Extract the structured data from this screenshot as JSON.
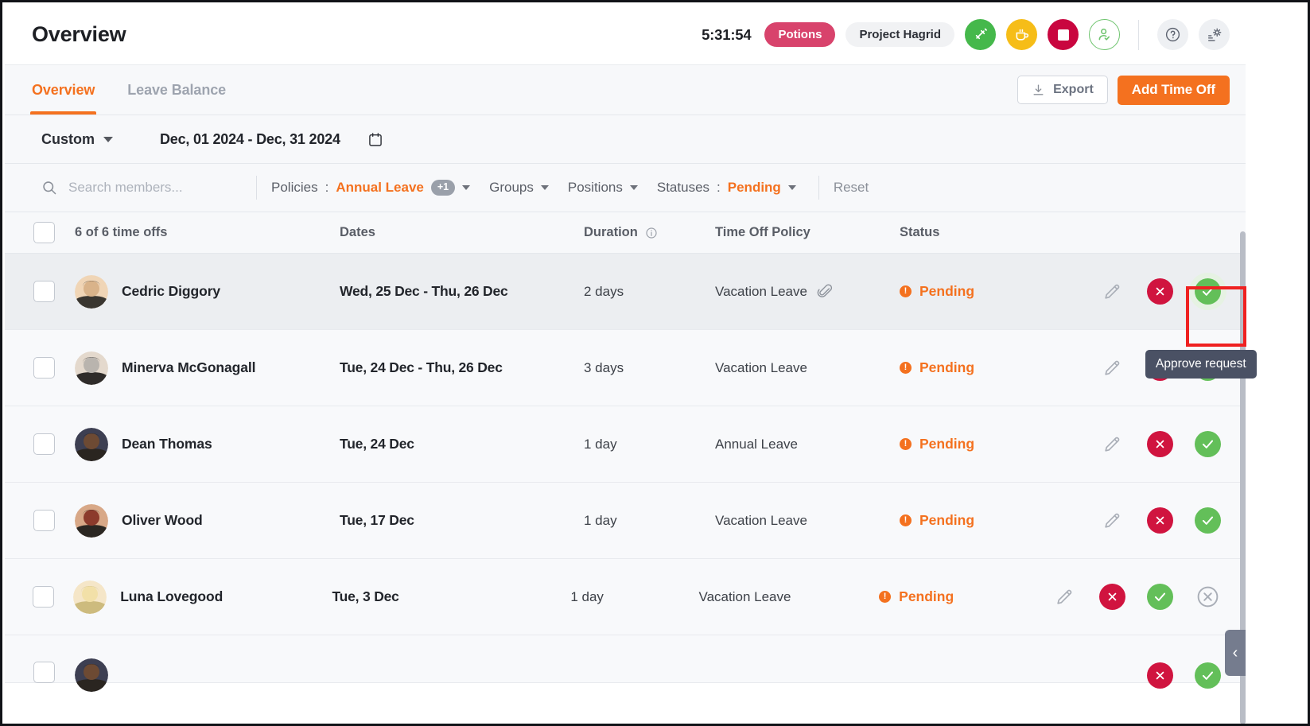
{
  "header": {
    "title": "Overview",
    "clock": "5:31:54",
    "task_pill": "Potions",
    "project_pill": "Project Hagrid",
    "icons": {
      "resume": "tracker-resume-icon",
      "break": "coffee-break-icon",
      "stop": "stop-tracker-icon",
      "checkin": "person-check-icon",
      "help": "help-icon",
      "settings": "settings-icon"
    }
  },
  "tabs": [
    {
      "label": "Overview",
      "active": true
    },
    {
      "label": "Leave Balance",
      "active": false
    }
  ],
  "actions": {
    "export_label": "Export",
    "add_label": "Add Time Off"
  },
  "daterange": {
    "preset": "Custom",
    "range": "Dec, 01 2024 - Dec, 31 2024"
  },
  "filters": {
    "search_placeholder": "Search members...",
    "search_value": "",
    "policies_label": "Policies",
    "policies_value": "Annual Leave",
    "policies_extra": "+1",
    "groups_label": "Groups",
    "positions_label": "Positions",
    "statuses_label": "Statuses",
    "statuses_value": "Pending",
    "reset_label": "Reset"
  },
  "table": {
    "count_label": "6 of 6 time offs",
    "columns": [
      "Dates",
      "Duration",
      "Time Off Policy",
      "Status"
    ],
    "rows": [
      {
        "name": "Cedric Diggory",
        "dates": "Wed, 25 Dec - Thu, 26 Dec",
        "duration": "2 days",
        "policy": "Vacation Leave",
        "has_attachment": true,
        "status": "Pending",
        "highlighted": true,
        "has_cancel": false
      },
      {
        "name": "Minerva McGonagall",
        "dates": "Tue, 24 Dec - Thu, 26 Dec",
        "duration": "3 days",
        "policy": "Vacation Leave",
        "has_attachment": false,
        "status": "Pending",
        "highlighted": false,
        "has_cancel": false
      },
      {
        "name": "Dean Thomas",
        "dates": "Tue, 24 Dec",
        "duration": "1 day",
        "policy": "Annual Leave",
        "has_attachment": false,
        "status": "Pending",
        "highlighted": false,
        "has_cancel": false
      },
      {
        "name": "Oliver Wood",
        "dates": "Tue, 17 Dec",
        "duration": "1 day",
        "policy": "Vacation Leave",
        "has_attachment": false,
        "status": "Pending",
        "highlighted": false,
        "has_cancel": false
      },
      {
        "name": "Luna Lovegood",
        "dates": "Tue, 3 Dec",
        "duration": "1 day",
        "policy": "Vacation Leave",
        "has_attachment": false,
        "status": "Pending",
        "highlighted": false,
        "has_cancel": true
      }
    ]
  },
  "tooltip": {
    "text": "Approve request"
  },
  "colors": {
    "accent": "#f4711f",
    "approve": "#63bf59",
    "reject": "#d0143f",
    "highlight_box": "#ef2121",
    "task_pill": "#d8436c"
  }
}
